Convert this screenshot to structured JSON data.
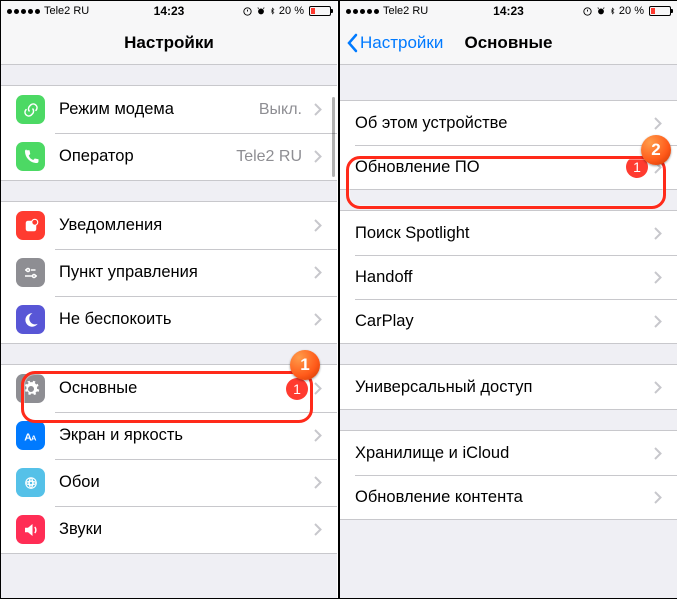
{
  "status": {
    "carrier": "Tele2 RU",
    "time": "14:23",
    "battery_pct": "20 %"
  },
  "left": {
    "title": "Настройки",
    "group1": [
      {
        "label": "Режим модема",
        "detail": "Выкл."
      },
      {
        "label": "Оператор",
        "detail": "Tele2 RU"
      }
    ],
    "group2": [
      {
        "label": "Уведомления"
      },
      {
        "label": "Пункт управления"
      },
      {
        "label": "Не беспокоить"
      }
    ],
    "group3": [
      {
        "label": "Основные",
        "badge": "1"
      },
      {
        "label": "Экран и яркость"
      },
      {
        "label": "Обои"
      },
      {
        "label": "Звуки"
      }
    ]
  },
  "right": {
    "back": "Настройки",
    "title": "Основные",
    "group1": [
      {
        "label": "Об этом устройстве"
      },
      {
        "label": "Обновление ПО",
        "badge": "1"
      }
    ],
    "group2": [
      {
        "label": "Поиск Spotlight"
      },
      {
        "label": "Handoff"
      },
      {
        "label": "CarPlay"
      }
    ],
    "group3": [
      {
        "label": "Универсальный доступ"
      }
    ],
    "group4": [
      {
        "label": "Хранилище и iCloud"
      },
      {
        "label": "Обновление контента"
      }
    ]
  },
  "callouts": {
    "one": "1",
    "two": "2"
  }
}
